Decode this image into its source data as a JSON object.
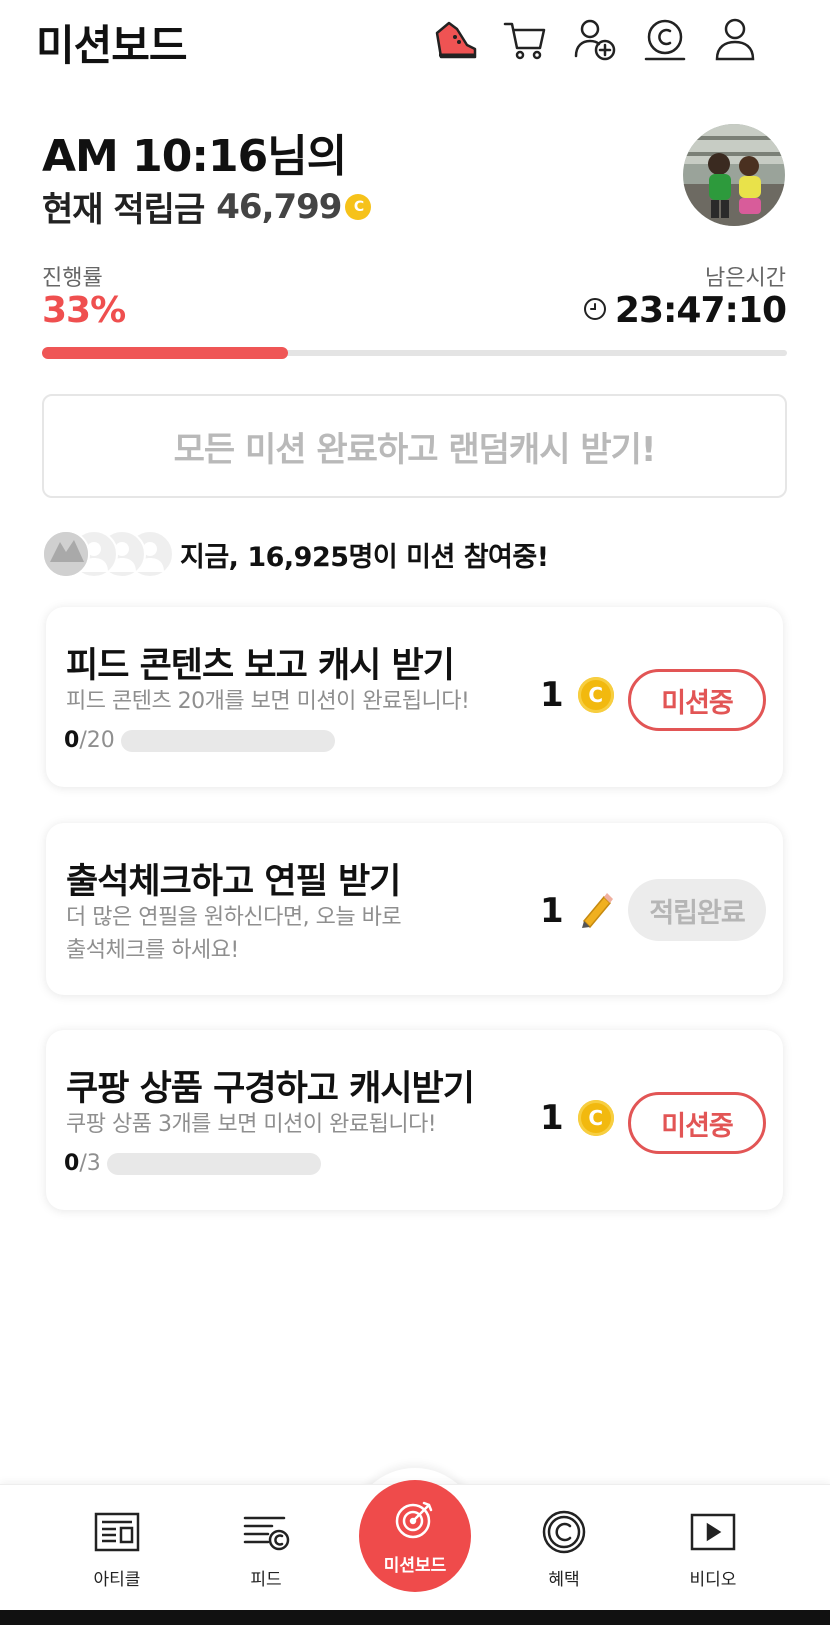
{
  "header": {
    "title": "미션보드",
    "icons": [
      "sneaker-icon",
      "cart-icon",
      "add-friend-icon",
      "cash-coin-icon",
      "profile-icon"
    ]
  },
  "user": {
    "greeting": "AM 10:16님의",
    "balance_label": "현재 적립금",
    "balance_value": "46,799",
    "coin_symbol": "C"
  },
  "progress": {
    "label": "진행률",
    "value_text": "33%",
    "fraction": 0.33,
    "remain_label": "남은시간",
    "remain_value": "23:47:10"
  },
  "banner": {
    "text": "모든 미션 완료하고 랜덤캐시 받기!"
  },
  "participants": {
    "prefix": "지금,",
    "count": "16,925명",
    "suffix": "이 미션 참여중!"
  },
  "missions": [
    {
      "title": "피드 콘텐츠 보고 캐시 받기",
      "desc": "피드 콘텐츠 20개를 보면 미션이 완료됩니다!",
      "count_done": "0",
      "count_total": "/20",
      "reward": "1",
      "reward_icon": "coin-icon",
      "button": "미션중",
      "state": "active"
    },
    {
      "title": "출석체크하고 연필 받기",
      "desc_line1": "더 많은 연필을 원하신다면, 오늘 바로",
      "desc_line2": "출석체크를 하세요!",
      "reward": "1",
      "reward_icon": "pencil-icon",
      "button": "적립완료",
      "state": "done"
    },
    {
      "title": "쿠팡 상품 구경하고 캐시받기",
      "desc": "쿠팡 상품 3개를 보면 미션이 완료됩니다!",
      "count_done": "0",
      "count_total": "/3",
      "reward": "1",
      "reward_icon": "coin-icon",
      "button": "미션중",
      "state": "active"
    }
  ],
  "nav": {
    "items": [
      {
        "label": "아티클",
        "icon": "article-icon"
      },
      {
        "label": "피드",
        "icon": "feed-icon"
      },
      {
        "label": "미션보드",
        "icon": "target-icon",
        "active": true
      },
      {
        "label": "혜택",
        "icon": "benefit-icon"
      },
      {
        "label": "비디오",
        "icon": "video-icon"
      }
    ]
  },
  "colors": {
    "accent": "#ef4f4f",
    "coin": "#f2b90f",
    "pencil": "#f0b020"
  }
}
